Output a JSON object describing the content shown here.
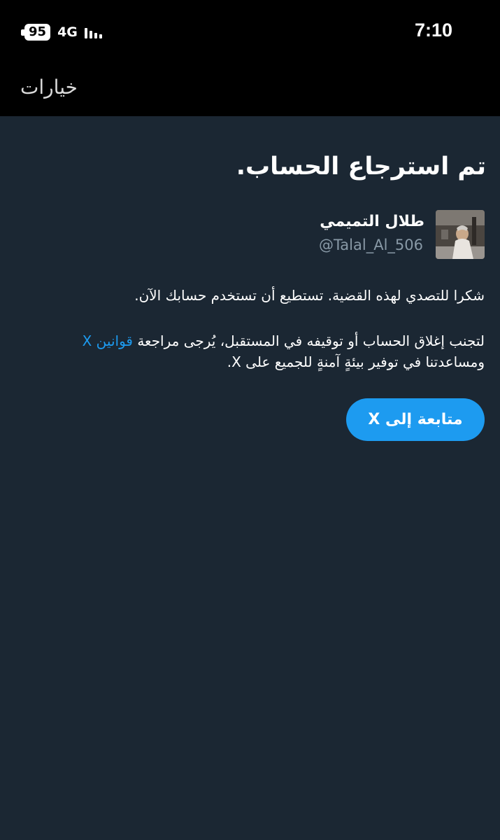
{
  "status_bar": {
    "battery": "95",
    "network": "4G",
    "time": "7:10"
  },
  "nav": {
    "options_label": "خيارات"
  },
  "main": {
    "title": "تم استرجاع الحساب.",
    "user": {
      "name": "طلال التميمي",
      "handle": "@Talal_Al_506"
    },
    "thanks_text": "شكرا للتصدي لهذه القضية. تستطيع أن تستخدم حسابك الآن.",
    "rules_text_before": "لتجنب إغلاق الحساب أو توقيفه في المستقبل، يُرجى مراجعة ",
    "rules_link": "قوانين X",
    "rules_text_after": "ومساعدتنا في توفير بيئةٍ آمنةٍ للجميع على X.",
    "continue_button": "متابعة إلى X"
  },
  "colors": {
    "background": "#1b2733",
    "accent": "#1d9bf0",
    "bar": "#000000"
  }
}
